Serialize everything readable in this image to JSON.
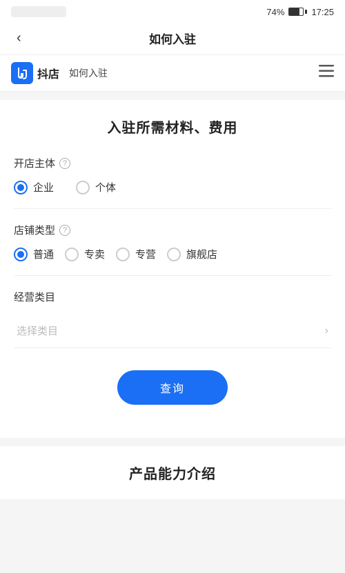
{
  "statusBar": {
    "battery": "74%",
    "time": "17:25"
  },
  "navBar": {
    "backIcon": "‹",
    "title": "如何入驻"
  },
  "brandBar": {
    "logoAlt": "抖店logo",
    "brandName": "抖店",
    "subtitle": "如何入驻",
    "menuIcon": "menu"
  },
  "mainContent": {
    "sectionTitle": "入驻所需材料、费用",
    "ownerTypeLabel": "开店主体",
    "ownerTypeHelpIcon": "?",
    "ownerTypes": [
      {
        "label": "企业",
        "checked": true
      },
      {
        "label": "个体",
        "checked": false
      }
    ],
    "shopTypeLabel": "店铺类型",
    "shopTypeHelpIcon": "?",
    "shopTypes": [
      {
        "label": "普通",
        "checked": true
      },
      {
        "label": "专卖",
        "checked": false
      },
      {
        "label": "专营",
        "checked": false
      },
      {
        "label": "旗舰店",
        "checked": false
      }
    ],
    "categoryLabel": "经营类目",
    "categoryPlaceholder": "选择类目",
    "queryButton": "查询"
  },
  "bottomSection": {
    "title": "产品能力介绍"
  }
}
